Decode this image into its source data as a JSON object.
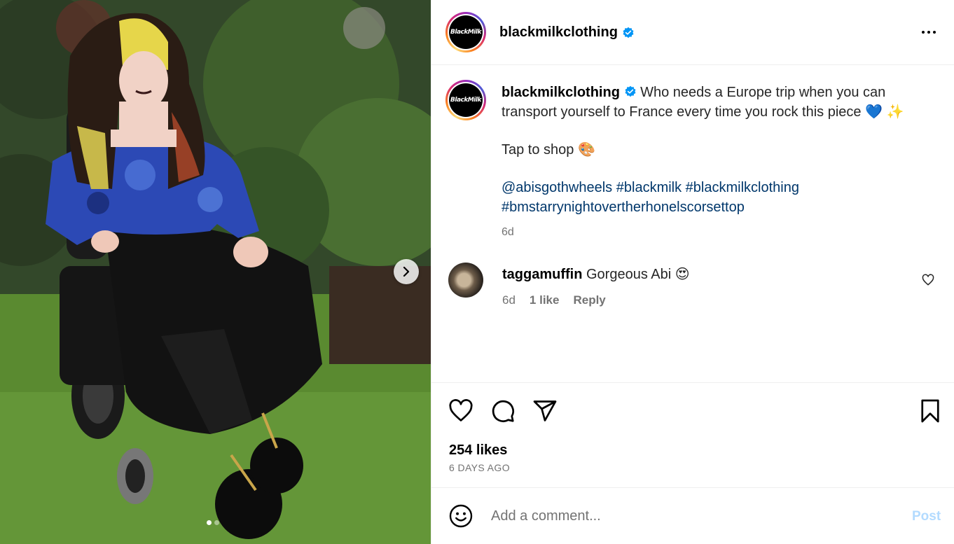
{
  "post": {
    "username": "blackmilkclothing",
    "avatar_text": "BlackMilk",
    "verified_icon": "verified-badge-icon",
    "more_icon": "more-options-icon"
  },
  "caption": {
    "username": "blackmilkclothing",
    "line1": "Who needs a Europe trip when you can transport yourself to France every time you rock this piece 💙 ✨",
    "line2": "Tap to shop 🎨",
    "mention": "@abisgothwheels",
    "hashtags": [
      "#blackmilk",
      "#blackmilkclothing",
      "#bmstarrynightovertherhonelscorsettop"
    ],
    "time": "6d"
  },
  "comment": {
    "username": "taggamuffin",
    "text": "Gorgeous Abi 😍",
    "time": "6d",
    "likes": "1 like",
    "reply": "Reply"
  },
  "actions": {
    "likes": "254 likes",
    "date": "6 DAYS AGO"
  },
  "add_comment": {
    "placeholder": "Add a comment...",
    "post_label": "Post"
  },
  "carousel": {
    "slide_count": 2,
    "active_slide": 1
  },
  "colors": {
    "link": "#00376b",
    "verified": "#0095f6",
    "muted": "#737373",
    "post_disabled": "#b3dbff"
  }
}
